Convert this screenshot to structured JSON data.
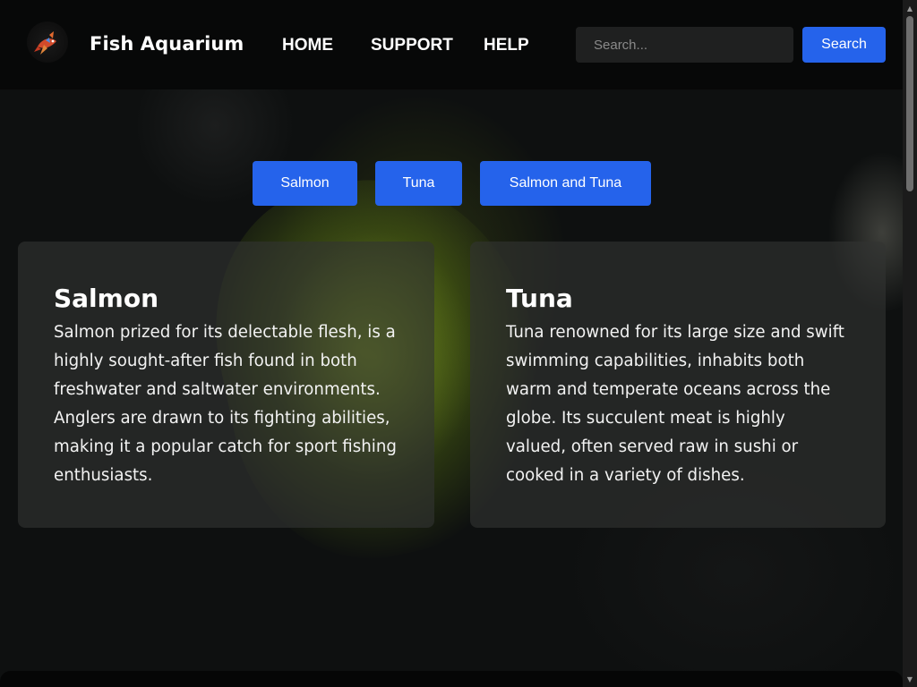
{
  "header": {
    "title": "Fish Aquarium",
    "logo_icon": "fish-logo-icon",
    "nav": [
      {
        "label": "HOME"
      },
      {
        "label": "SUPPORT"
      },
      {
        "label": "HELP"
      }
    ],
    "search": {
      "placeholder": "Search...",
      "value": "",
      "button_label": "Search"
    }
  },
  "filters": [
    {
      "label": "Salmon"
    },
    {
      "label": "Tuna"
    },
    {
      "label": "Salmon and Tuna"
    }
  ],
  "cards": [
    {
      "title": "Salmon",
      "text": "Salmon prized for its delectable flesh, is a highly sought-after fish found in both freshwater and saltwater environments. Anglers are drawn to its fighting abilities, making it a popular catch for sport fishing enthusiasts."
    },
    {
      "title": "Tuna",
      "text": "Tuna renowned for its large size and swift swimming capabilities, inhabits both warm and temperate oceans across the globe. Its succulent meat is highly valued, often served raw in sushi or cooked in a variety of dishes."
    }
  ],
  "colors": {
    "accent": "#2563eb",
    "header_bg": "#070808",
    "card_bg": "#323432"
  }
}
